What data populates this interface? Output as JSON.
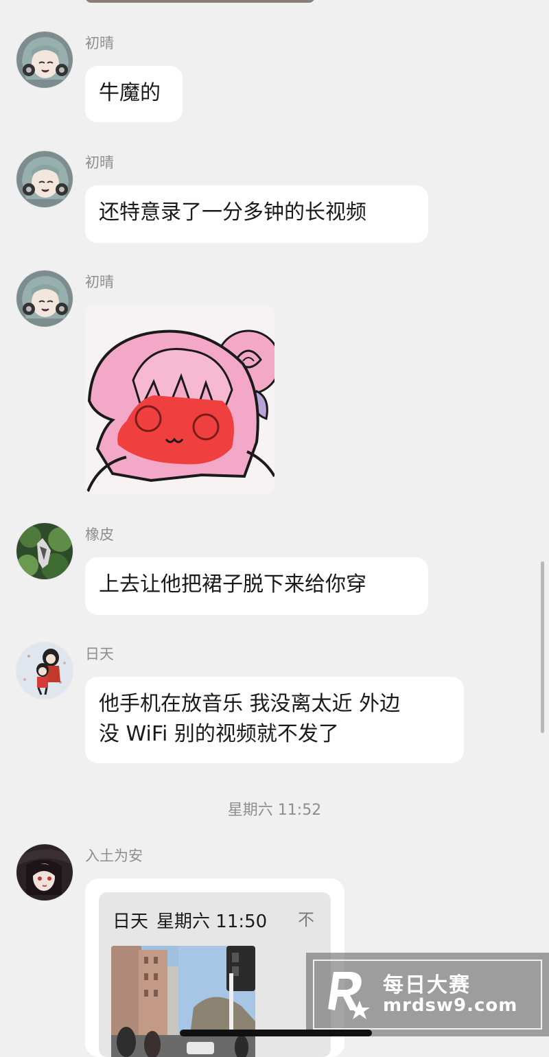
{
  "messages": [
    {
      "sender": "初晴",
      "lines": [
        "牛魔的"
      ]
    },
    {
      "sender": "初晴",
      "lines": [
        "还特意录了一分多钟的长视频"
      ]
    },
    {
      "sender": "初晴",
      "sticker": "pink-haired anime girl sticker"
    },
    {
      "sender": "橡皮",
      "lines": [
        "上去让他把裙子脱下来给你穿"
      ]
    },
    {
      "sender": "日天",
      "lines": [
        "他手机在放音乐 我没离太近 外边",
        "没 WiFi 别的视频就不发了"
      ]
    }
  ],
  "timestamp": "星期六 11:52",
  "forwarded": {
    "sender": "入土为安",
    "origin_sender": "日天",
    "origin_time": "星期六 11:50",
    "more_icon": "不"
  },
  "watermark": {
    "line1": "每日大赛",
    "line2": "mrdsw9.com"
  },
  "colors": {
    "background": "#f0f0f0",
    "bubble": "#ffffff",
    "sender_text": "#8e8e8e"
  }
}
